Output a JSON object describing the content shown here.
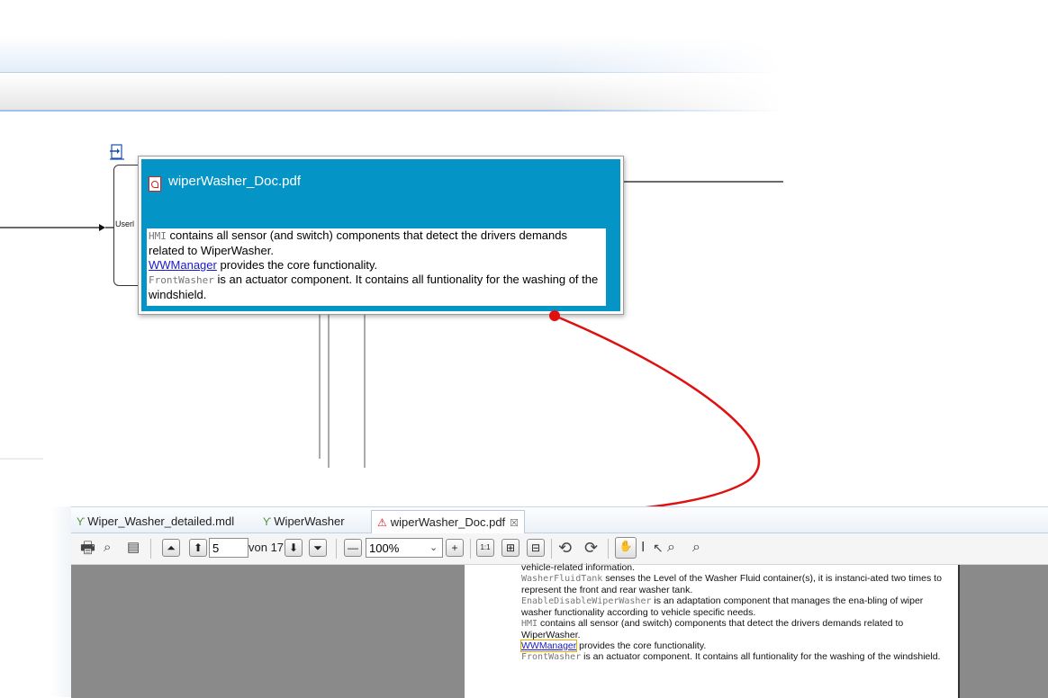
{
  "popup": {
    "title": "wiperWasher_Doc.pdf",
    "lines": [
      {
        "code": "HMI",
        "text": " contains all sensor (and switch) components that detect the drivers demands related to WiperWasher."
      },
      {
        "link": "WWManager",
        "text": " provides the core functionality."
      },
      {
        "code": "FrontWasher",
        "text": " is an actuator component. It contains all funtionality for the washing of the windshield."
      }
    ]
  },
  "diagram": {
    "port_label": "Userl"
  },
  "tabs": [
    {
      "label": "Wiper_Washer_detailed.mdl",
      "icon": "model-icon"
    },
    {
      "label": "WiperWasher",
      "icon": "model-icon"
    },
    {
      "label": "wiperWasher_Doc.pdf",
      "icon": "pdf-icon",
      "active": true,
      "close": "☒"
    }
  ],
  "toolbar": {
    "page_number": "5",
    "page_of": "von 17",
    "zoom": "100%",
    "fit_actual": "1:1"
  },
  "document": {
    "line0": "vehicle-related information.",
    "washer_code": "WasherFluidTank",
    "washer_text": " senses the Level of the Washer Fluid container(s), it is instanci-ated two times to represent the front and rear washer tank.",
    "enable_code": "EnableDisableWiperWasher",
    "enable_text": " is an adaptation component that manages the ena-bling of wiper washer functionality according to vehicle specific needs.",
    "hmi_code": "HMI",
    "hmi_text": " contains all sensor (and switch) components that detect the drivers demands related to WiperWasher.",
    "ww_link": "WWManager",
    "ww_text": " provides the core functionality.",
    "front_code": "FrontWasher",
    "front_text": " is an actuator component. It contains all funtionality for the washing of the windshield."
  },
  "colors": {
    "popup_bg": "#0494c6",
    "arrow": "#e01010",
    "link": "#1a1acc"
  }
}
